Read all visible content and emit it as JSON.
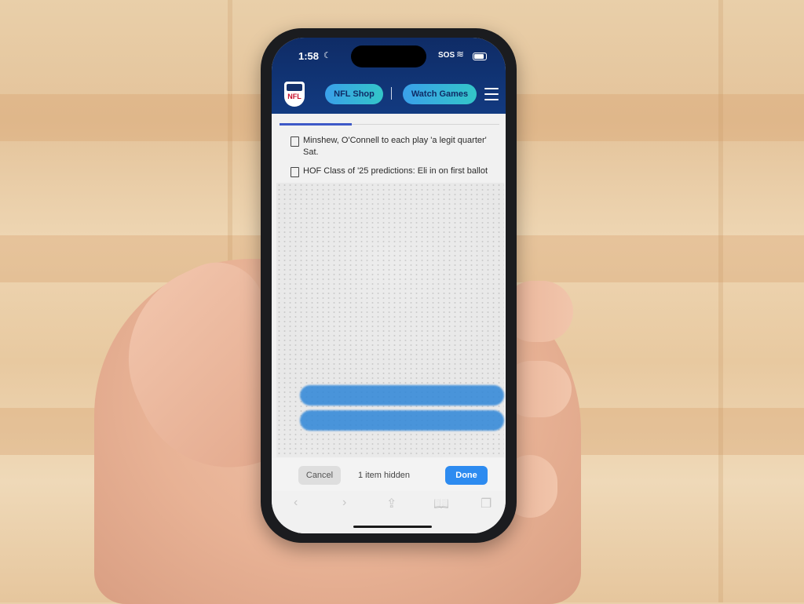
{
  "status_bar": {
    "time": "1:58",
    "focus_icon": "moon-icon",
    "carrier": "SOS",
    "wifi_icon": "wifi-icon",
    "battery_icon": "battery-icon"
  },
  "site_header": {
    "logo_text": "NFL",
    "buttons": [
      {
        "label": "NFL Shop"
      },
      {
        "label": "Watch Games"
      }
    ],
    "menu_icon": "hamburger-menu-icon"
  },
  "news": {
    "items": [
      {
        "text": "Minshew, O'Connell to each play 'a legit quarter' Sat."
      },
      {
        "text": "HOF Class of '25 predictions: Eli in on first ballot"
      }
    ]
  },
  "hide_toolbar": {
    "cancel_label": "Cancel",
    "status_label": "1 item hidden",
    "done_label": "Done"
  },
  "browser_nav": {
    "icons": [
      "back-icon",
      "forward-icon",
      "share-icon",
      "bookmarks-icon",
      "tabs-icon"
    ],
    "glyphs": [
      "‹",
      "›",
      "⇪",
      "📖",
      "❐"
    ]
  },
  "colors": {
    "header_bg": "#123a80",
    "pill_gradient_start": "#3aa0ea",
    "pill_gradient_end": "#33c6c8",
    "done_button": "#2d8bf0",
    "tab_active": "#3e59c7"
  }
}
